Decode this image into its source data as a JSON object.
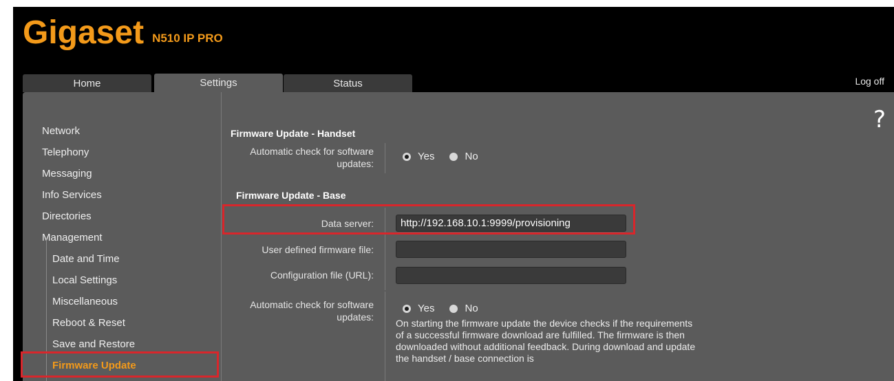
{
  "brand": {
    "name": "Gigaset",
    "model": "N510 IP PRO",
    "color": "#f39a1a"
  },
  "tabs": [
    {
      "label": "Home",
      "active": false
    },
    {
      "label": "Settings",
      "active": true
    },
    {
      "label": "Status",
      "active": false
    }
  ],
  "logoff": "Log off",
  "help": "?",
  "sidebar": {
    "items": [
      {
        "label": "Network"
      },
      {
        "label": "Telephony"
      },
      {
        "label": "Messaging"
      },
      {
        "label": "Info Services"
      },
      {
        "label": "Directories"
      },
      {
        "label": "Management"
      }
    ],
    "subitems": [
      {
        "label": "Date and Time"
      },
      {
        "label": "Local Settings"
      },
      {
        "label": "Miscellaneous"
      },
      {
        "label": "Reboot & Reset"
      },
      {
        "label": "Save and Restore"
      },
      {
        "label": "Firmware Update",
        "active": true
      }
    ]
  },
  "handset": {
    "title": "Firmware Update - Handset",
    "auto_check_label": "Automatic check for software updates:",
    "yes": "Yes",
    "no": "No",
    "selected": "Yes"
  },
  "base": {
    "title": "Firmware Update - Base",
    "data_server_label": "Data server:",
    "data_server_value": "http://192.168.10.1:9999/provisioning",
    "user_fw_label": "User defined firmware file:",
    "user_fw_value": "",
    "config_label": "Configuration file (URL):",
    "config_value": "",
    "auto_check_label": "Automatic check for software updates:",
    "yes": "Yes",
    "no": "No",
    "selected": "Yes",
    "info": "On starting the firmware update the device checks if the requirements of a successful firmware download are fulfilled. The firmware is then downloaded without additional feedback. During download and update the handset / base connection is"
  },
  "highlight_color": "#d9262b"
}
